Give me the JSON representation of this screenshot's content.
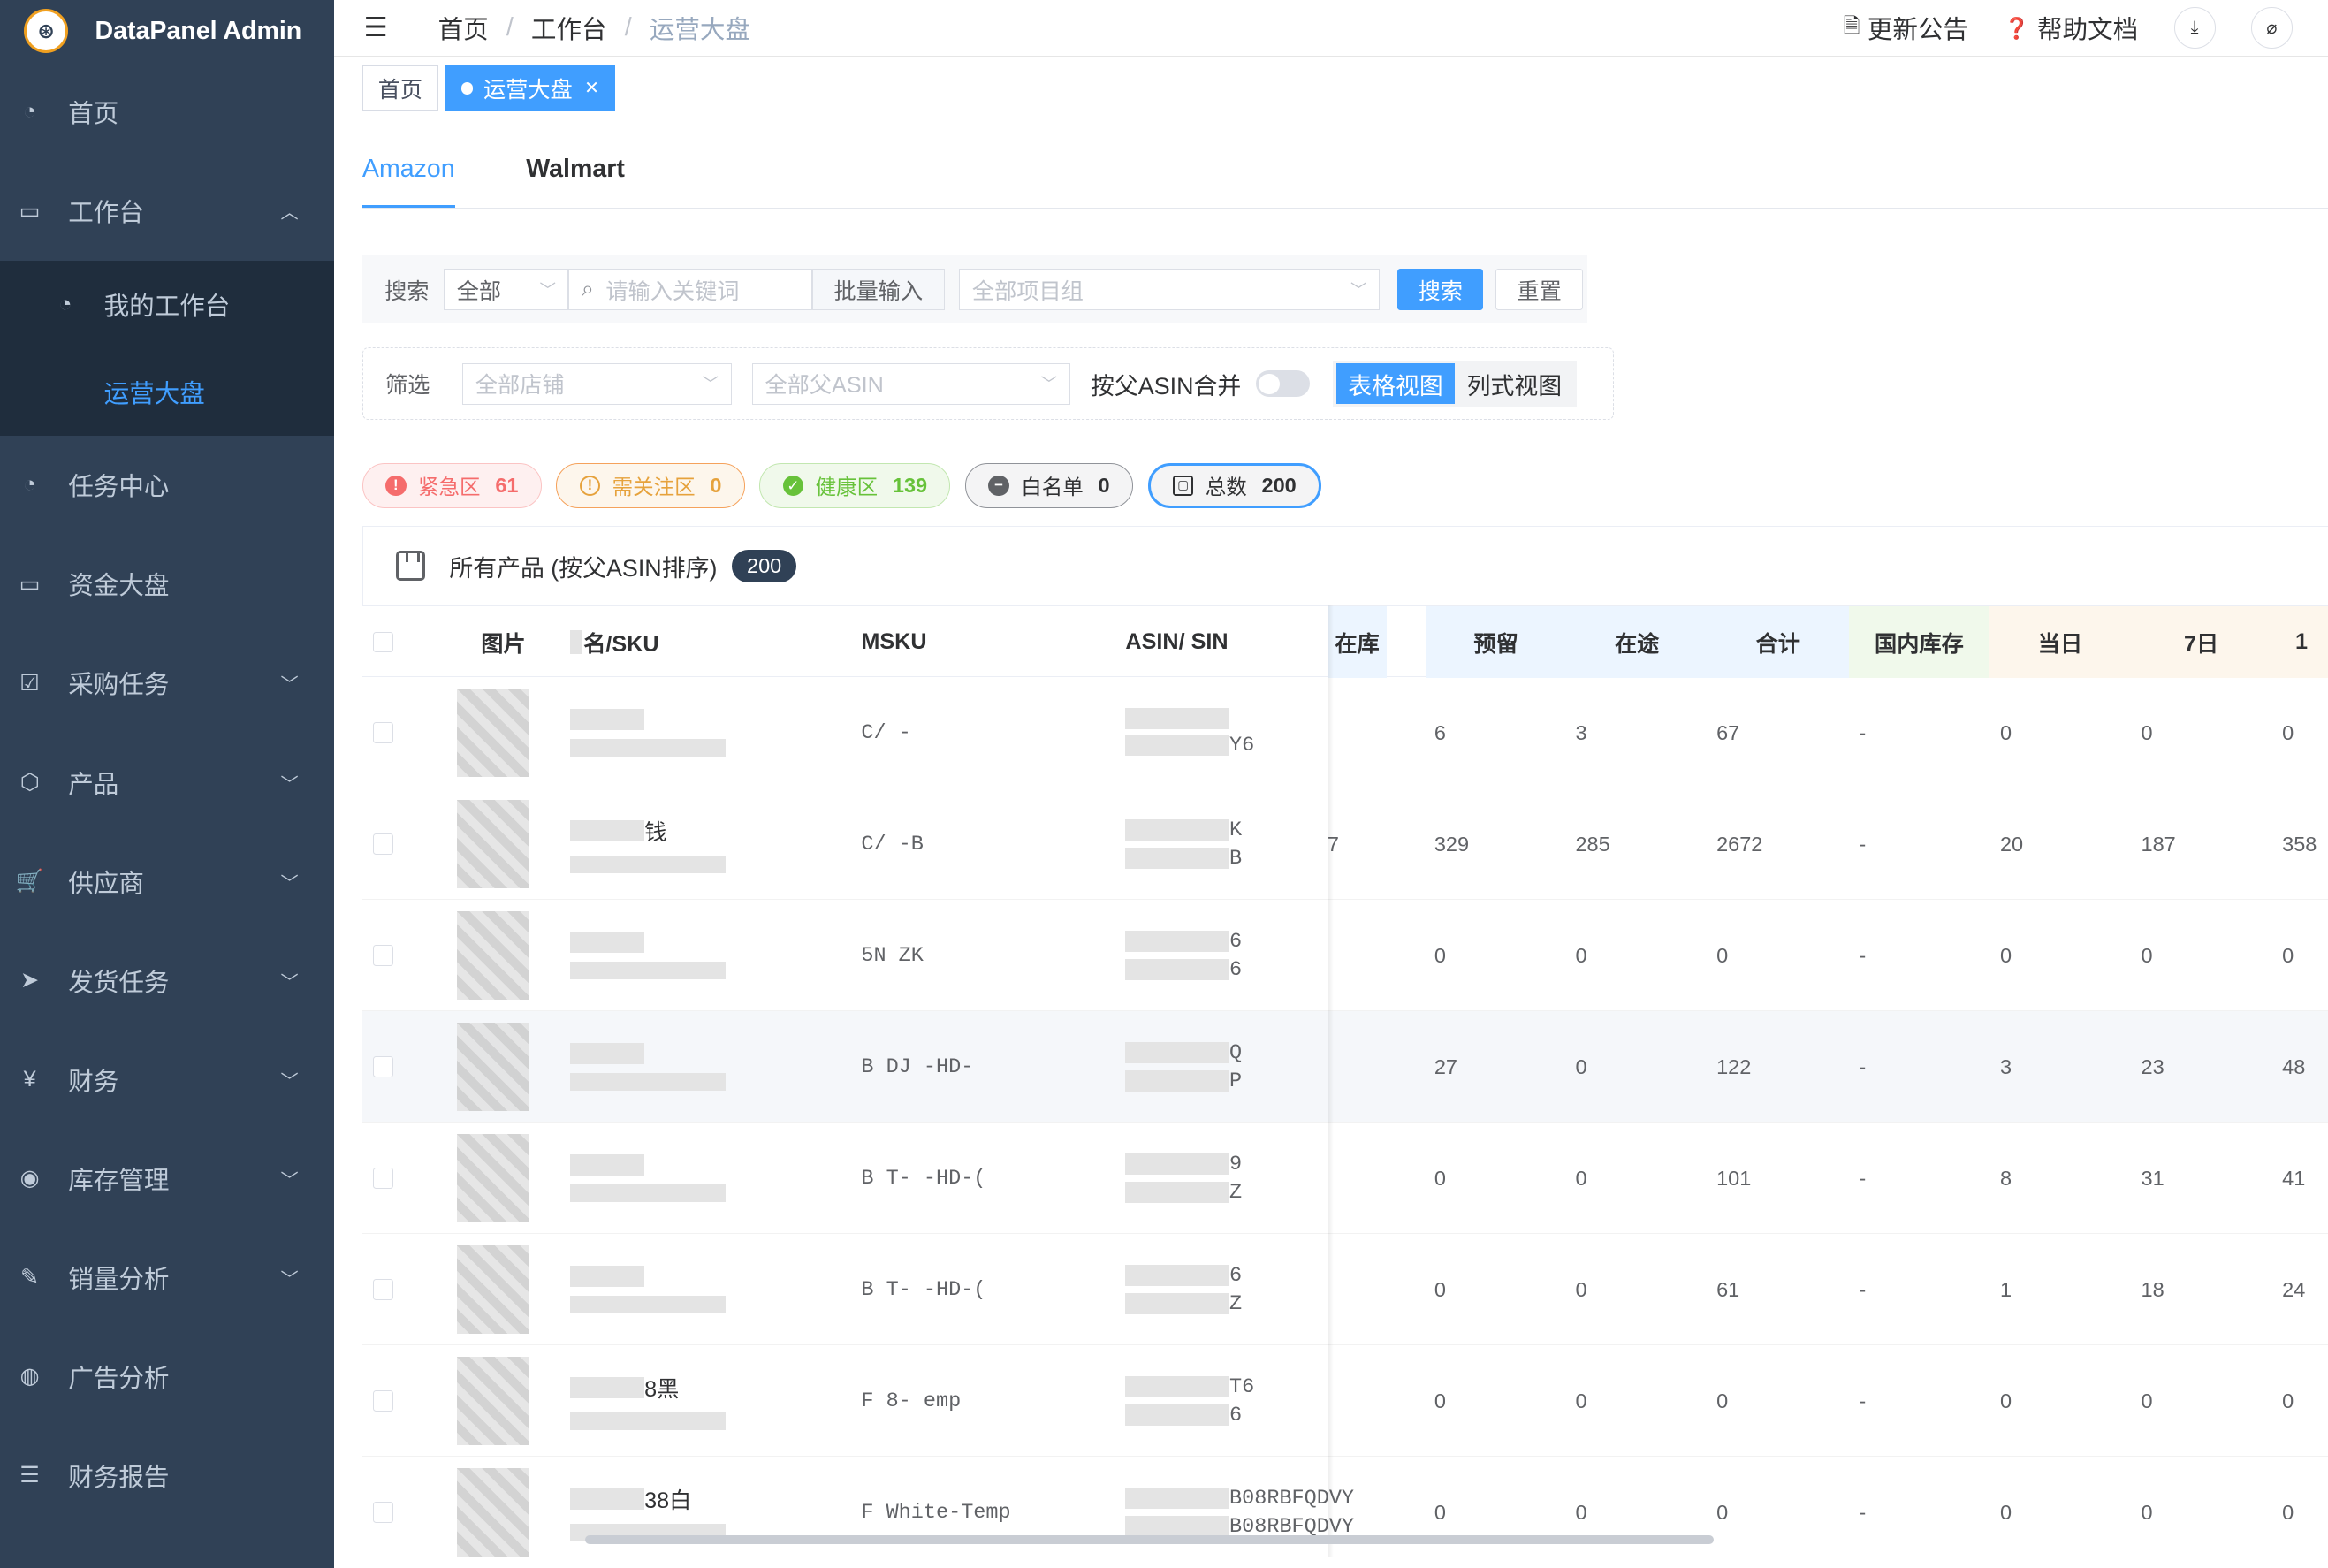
{
  "app": {
    "title": "DataPanel Admin"
  },
  "sidebar": {
    "items": [
      {
        "label": "首页",
        "icon": "dashboard-icon"
      },
      {
        "label": "工作台",
        "icon": "monitor-icon",
        "expanded": true
      },
      {
        "label": "任务中心",
        "icon": "dashboard-icon"
      },
      {
        "label": "资金大盘",
        "icon": "monitor-icon"
      },
      {
        "label": "采购任务",
        "icon": "checkbox-icon"
      },
      {
        "label": "产品",
        "icon": "box-icon"
      },
      {
        "label": "供应商",
        "icon": "cart-icon"
      },
      {
        "label": "发货任务",
        "icon": "send-icon"
      },
      {
        "label": "财务",
        "icon": "yen-icon"
      },
      {
        "label": "库存管理",
        "icon": "lifebuoy-icon"
      },
      {
        "label": "销量分析",
        "icon": "brush-icon"
      },
      {
        "label": "广告分析",
        "icon": "globe-icon"
      },
      {
        "label": "财务报告",
        "icon": "list-icon"
      }
    ],
    "sub": {
      "my_workspace": "我的工作台",
      "ops_dashboard": "运营大盘"
    }
  },
  "header": {
    "breadcrumb": [
      "首页",
      "工作台",
      "运营大盘"
    ],
    "announce": "更新公告",
    "help": "帮助文档"
  },
  "tagsview": {
    "home": "首页",
    "current": "运营大盘"
  },
  "tabs": [
    "Amazon",
    "Walmart"
  ],
  "search": {
    "label": "搜索",
    "scope": "全部",
    "keyword_placeholder": "请输入关键词",
    "batch": "批量输入",
    "group_placeholder": "全部项目组",
    "search_btn": "搜索",
    "reset_btn": "重置"
  },
  "filter": {
    "label": "筛选",
    "store_placeholder": "全部店铺",
    "parent_placeholder": "全部父ASIN",
    "merge_label": "按父ASIN合并",
    "merge_on": false,
    "view_table": "表格视图",
    "view_list": "列式视图"
  },
  "zones": [
    {
      "label": "紧急区",
      "count": "61"
    },
    {
      "label": "需关注区",
      "count": "0"
    },
    {
      "label": "健康区",
      "count": "139"
    },
    {
      "label": "白名单",
      "count": "0"
    },
    {
      "label": "总数",
      "count": "200"
    }
  ],
  "products": {
    "title": "所有产品 (按父ASIN排序)",
    "count": "200"
  },
  "table": {
    "headers": [
      "图片",
      "名/SKU",
      "MSKU",
      "ASIN/ SIN",
      "在库",
      "预留",
      "在途",
      "合计",
      "国内库存",
      "当日",
      "7日",
      "1"
    ],
    "rows": [
      {
        "name": "",
        "msku": "C/   -",
        "asin1": "",
        "asin2": "Y6",
        "instock": "",
        "reserved": "6",
        "transit": "3",
        "total": "67",
        "domestic": "-",
        "today": "0",
        "d7": "0",
        "d30": "0"
      },
      {
        "name": "钱",
        "msku": "C/   -B",
        "asin1": "K",
        "asin2": "B",
        "instock": "7",
        "reserved": "329",
        "transit": "285",
        "total": "2672",
        "domestic": "-",
        "today": "20",
        "d7": "187",
        "d30": "358"
      },
      {
        "name": "",
        "msku": "5N  ZK",
        "asin1": "6",
        "asin2": "6",
        "instock": "",
        "reserved": "0",
        "transit": "0",
        "total": "0",
        "domestic": "-",
        "today": "0",
        "d7": "0",
        "d30": "0"
      },
      {
        "name": "",
        "msku": "B   DJ  -HD-",
        "asin1": "Q",
        "asin2": "P",
        "instock": "",
        "reserved": "27",
        "transit": "0",
        "total": "122",
        "domestic": "-",
        "today": "3",
        "d7": "23",
        "d30": "48"
      },
      {
        "name": "",
        "msku": "B   T-   -HD-(",
        "asin1": "9",
        "asin2": "Z",
        "instock": "",
        "reserved": "0",
        "transit": "0",
        "total": "101",
        "domestic": "-",
        "today": "8",
        "d7": "31",
        "d30": "41"
      },
      {
        "name": "",
        "msku": "B   T-   -HD-(",
        "asin1": "6",
        "asin2": "Z",
        "instock": "",
        "reserved": "0",
        "transit": "0",
        "total": "61",
        "domestic": "-",
        "today": "1",
        "d7": "18",
        "d30": "24"
      },
      {
        "name": "8黑",
        "msku": "F   8-      emp",
        "asin1": "T6",
        "asin2": "6",
        "instock": "",
        "reserved": "0",
        "transit": "0",
        "total": "0",
        "domestic": "-",
        "today": "0",
        "d7": "0",
        "d30": "0"
      },
      {
        "name": "38白",
        "msku": "F     White-Temp",
        "asin1": "B08RBFQDVY",
        "asin2": "B08RBFQDVY",
        "instock": "",
        "reserved": "0",
        "transit": "0",
        "total": "0",
        "domestic": "-",
        "today": "0",
        "d7": "0",
        "d30": "0"
      }
    ]
  },
  "colors": {
    "sidebar_bg": "#304156",
    "primary": "#409eff",
    "danger": "#f56c6c",
    "warning": "#e6a23c",
    "success": "#67c23a"
  }
}
